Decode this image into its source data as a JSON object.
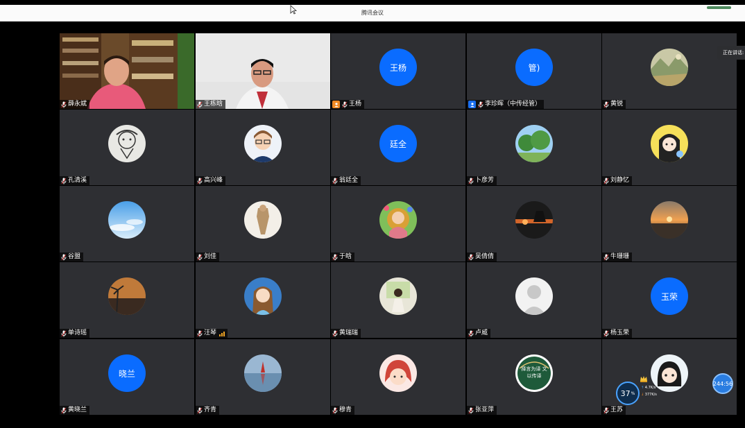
{
  "window": {
    "title": "腾讯会议"
  },
  "speaking_indicator": "正在讲话:",
  "network": {
    "percent": "37",
    "unit": "%",
    "upload": "4.7K/s",
    "download": "377K/s"
  },
  "timer": "244:56",
  "colors": {
    "tile_bg": "#2e2f33",
    "avatar_blue": "#0a6cff",
    "active_border": "#2fae5e"
  },
  "participants": [
    {
      "name": "薛永斌",
      "avatar": "video-feed",
      "active": true
    },
    {
      "name": "王栋晗",
      "avatar": "video-feed"
    },
    {
      "name": "王杨",
      "avatar_text": "王杨",
      "host_badge": "orange"
    },
    {
      "name": "李珍晖（中传经管）",
      "avatar_text": "管)",
      "host_badge": "blue"
    },
    {
      "name": "黄锐",
      "avatar": "landscape-painting"
    },
    {
      "name": "孔清溪",
      "avatar": "sketch-drawing"
    },
    {
      "name": "高兴峰",
      "avatar": "cartoon-man"
    },
    {
      "name": "翁廷全",
      "avatar_text": "廷全"
    },
    {
      "name": "卜彦芳",
      "avatar": "trees"
    },
    {
      "name": "刘静忆",
      "avatar": "cartoon-girl"
    },
    {
      "name": "谷盟",
      "avatar": "sky"
    },
    {
      "name": "刘佳",
      "avatar": "figure-drawing"
    },
    {
      "name": "于晗",
      "avatar": "flower-girl"
    },
    {
      "name": "吴倩倩",
      "avatar": "sunset-silhouette"
    },
    {
      "name": "牛珊珊",
      "avatar": "sea-sunset"
    },
    {
      "name": "单诗瑶",
      "avatar": "palm-sunset"
    },
    {
      "name": "汪琴",
      "avatar": "anime-girl",
      "signal": true
    },
    {
      "name": "黄瑞瑞",
      "avatar": "photo-girl"
    },
    {
      "name": "卢威",
      "avatar": "default-person"
    },
    {
      "name": "杨玉荣",
      "avatar_text": "玉荣"
    },
    {
      "name": "黄晓兰",
      "avatar_text": "晓兰"
    },
    {
      "name": "齐青",
      "avatar": "reflection"
    },
    {
      "name": "穆青",
      "avatar": "cartoon-redhead"
    },
    {
      "name": "张亚萍",
      "avatar": "calligraphy",
      "avatar_caption": "择言为译 文以传译"
    },
    {
      "name": "王苏",
      "avatar": "cartoon-lady"
    }
  ]
}
